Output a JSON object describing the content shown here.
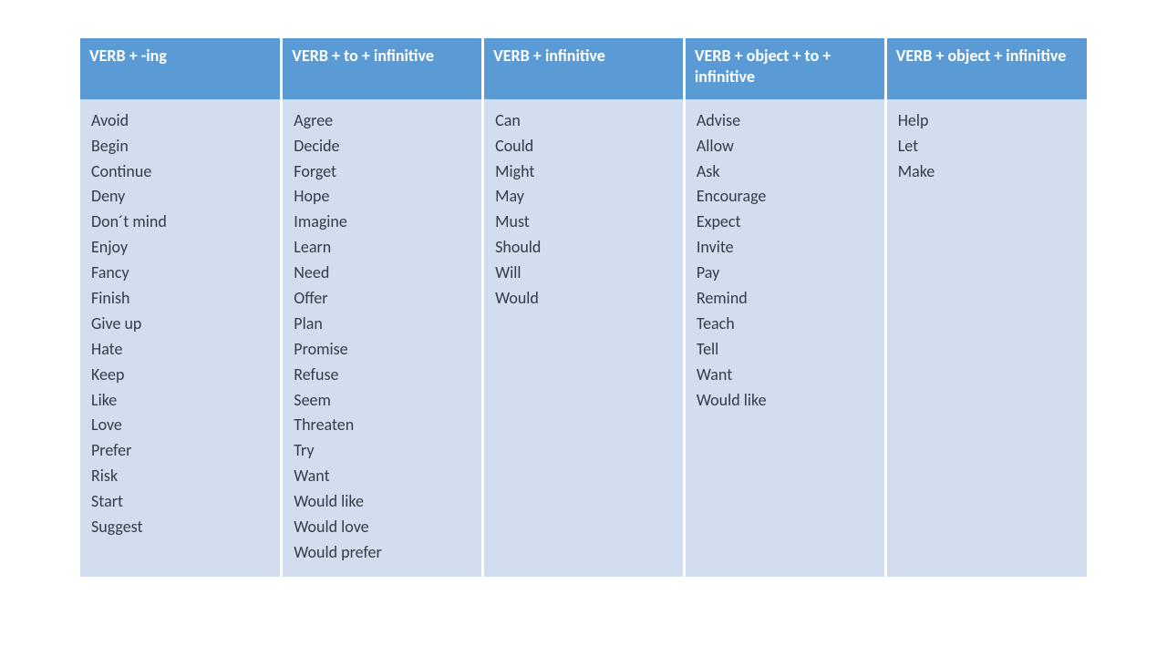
{
  "table": {
    "columns": [
      {
        "header": "VERB + -ing",
        "items": [
          "Avoid",
          "Begin",
          "Continue",
          "Deny",
          "Don´t mind",
          "Enjoy",
          "Fancy",
          "Finish",
          "Give up",
          "Hate",
          "Keep",
          "Like",
          "Love",
          "Prefer",
          "Risk",
          "Start",
          "Suggest"
        ]
      },
      {
        "header": "VERB + to + infinitive",
        "items": [
          "Agree",
          "Decide",
          "Forget",
          "Hope",
          "Imagine",
          "Learn",
          "Need",
          "Offer",
          "Plan",
          "Promise",
          "Refuse",
          "Seem",
          "Threaten",
          "Try",
          "Want",
          "Would like",
          "Would love",
          "Would prefer"
        ]
      },
      {
        "header": "VERB + infinitive",
        "items": [
          "Can",
          "Could",
          "Might",
          "May",
          "Must",
          "Should",
          "Will",
          "Would"
        ]
      },
      {
        "header": "VERB + object + to + infinitive",
        "items": [
          "Advise",
          "Allow",
          "Ask",
          "Encourage",
          "Expect",
          "Invite",
          "Pay",
          "Remind",
          "Teach",
          "Tell",
          "Want",
          "Would like"
        ]
      },
      {
        "header": "VERB + object + infinitive",
        "items": [
          "Help",
          "Let",
          "Make"
        ]
      }
    ]
  }
}
